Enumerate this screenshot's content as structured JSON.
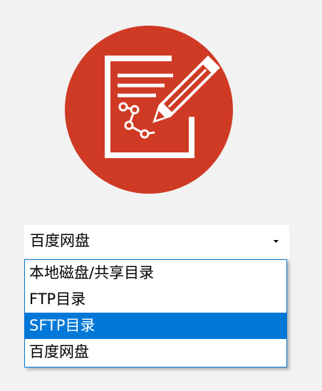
{
  "logo": {
    "icon": "edit-document-icon",
    "circle_color": "#cf3a25",
    "glyph_color": "#ffffff"
  },
  "storage_select": {
    "value": "百度网盘",
    "arrow_icon": "triangle-down-icon",
    "options": [
      {
        "label": "本地磁盘/共享目录",
        "selected": false
      },
      {
        "label": "FTP目录",
        "selected": false
      },
      {
        "label": "SFTP目录",
        "selected": true
      },
      {
        "label": "百度网盘",
        "selected": false
      }
    ],
    "highlight_color": "#0078d7"
  }
}
